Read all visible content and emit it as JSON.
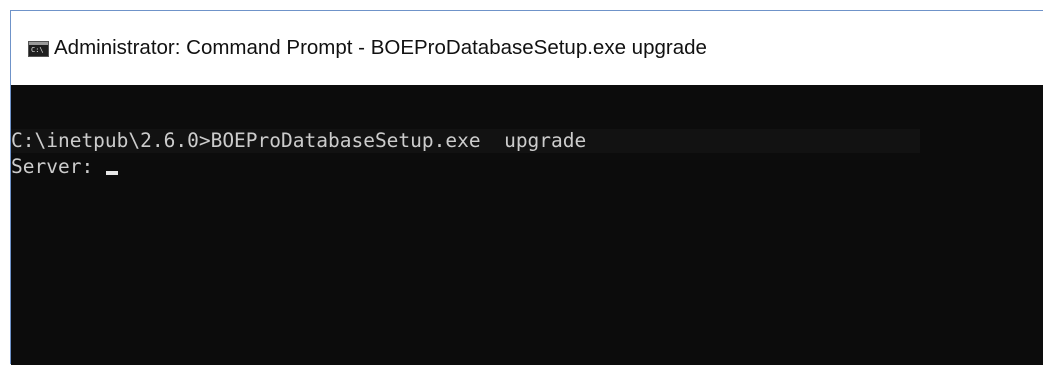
{
  "window": {
    "title": "Administrator: Command Prompt - BOEProDatabaseSetup.exe  upgrade",
    "icon": "cmd-icon"
  },
  "console": {
    "lines": [
      "C:\\inetpub\\2.6.0>BOEProDatabaseSetup.exe  upgrade",
      "Server: "
    ],
    "cursor": "blinking-underscore"
  },
  "colors": {
    "console_background": "#0c0c0c",
    "console_text": "#cccccc",
    "title_bar_background": "#ffffff",
    "window_border": "#6f93c9"
  }
}
